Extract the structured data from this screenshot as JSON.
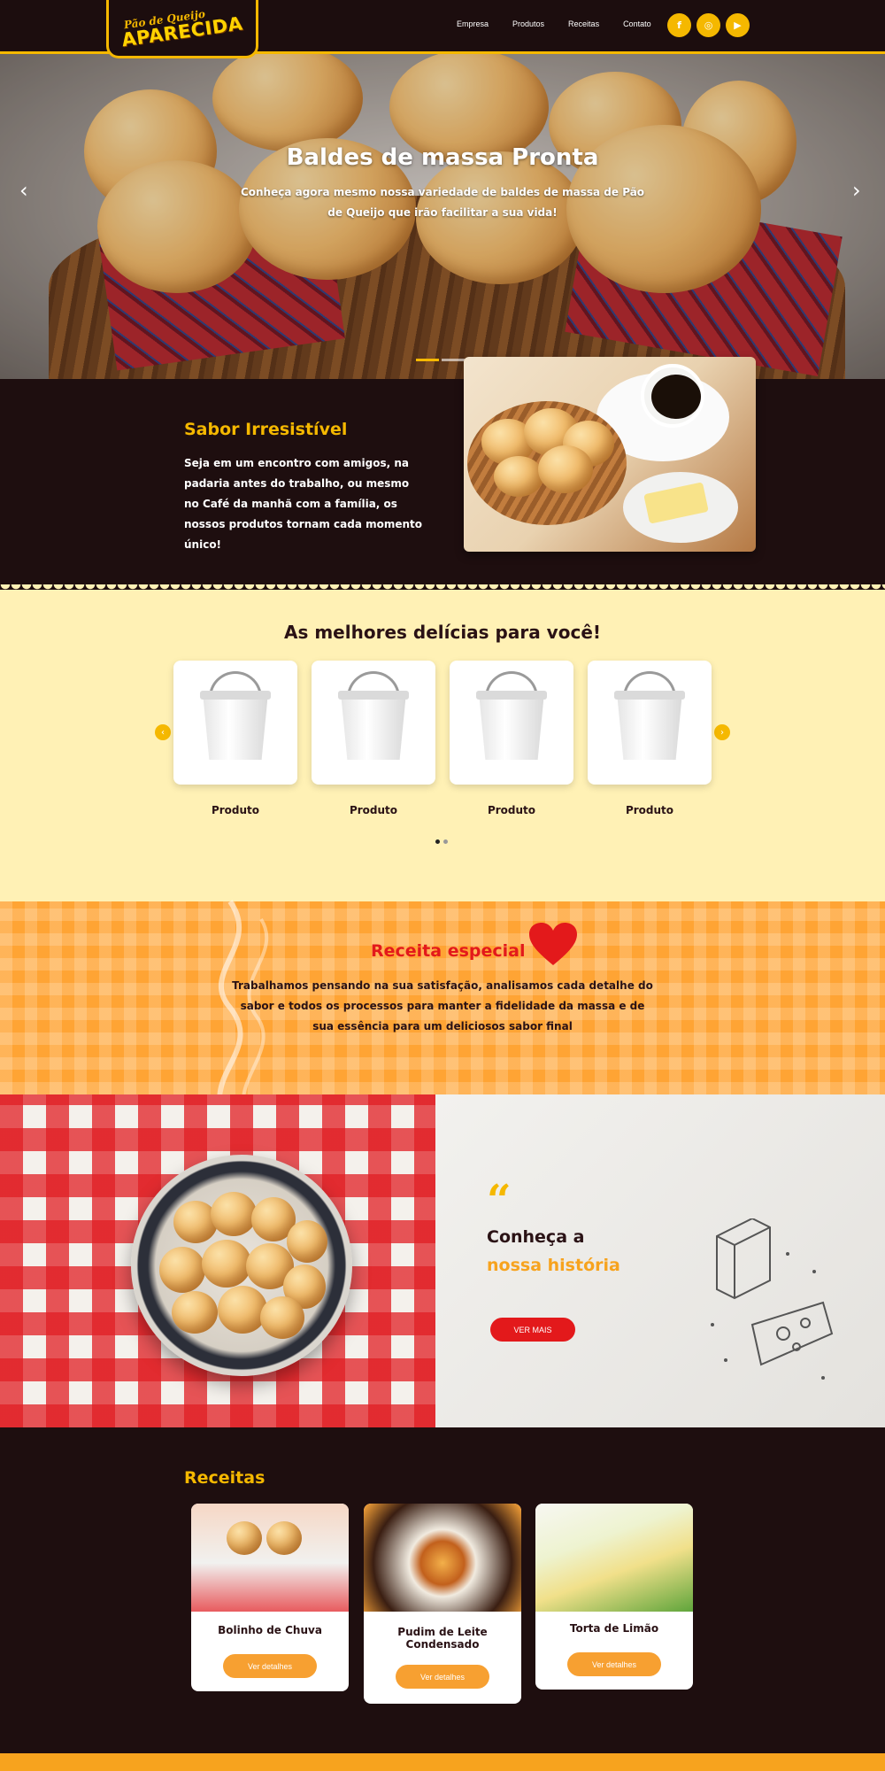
{
  "brand": {
    "logo_line1": "Pão de Queijo",
    "logo_line2": "APARECIDA"
  },
  "nav": {
    "items": [
      "Empresa",
      "Produtos",
      "Receitas",
      "Contato"
    ]
  },
  "social": {
    "icons": [
      "facebook-icon",
      "instagram-icon",
      "youtube-icon"
    ],
    "glyphs": [
      "f",
      "◎",
      "▶"
    ]
  },
  "hero": {
    "title": "Baldes de massa Pronta",
    "subtitle": "Conheça agora mesmo nossa variedade de baldes de massa de Pão de Queijo que irão facilitar a sua vida!",
    "prev": "‹",
    "next": "›",
    "active_slide": 0
  },
  "sabor": {
    "title": "Sabor Irresistível",
    "text": "Seja em um encontro com amigos, na padaria antes do trabalho, ou mesmo no Café da manhã com a família, os nossos produtos tornam cada momento único!"
  },
  "produtos": {
    "title": "As melhores delícias para você!",
    "items": [
      {
        "name": "Produto"
      },
      {
        "name": "Produto"
      },
      {
        "name": "Produto"
      },
      {
        "name": "Produto"
      }
    ],
    "prev": "‹",
    "next": "›"
  },
  "especial": {
    "title": "Receita especial",
    "text": "Trabalhamos pensando na sua satisfação, analisamos cada detalhe do sabor e todos os processos para manter a fidelidade da massa e de sua essência para um deliciosos sabor final"
  },
  "historia": {
    "quote": "“",
    "line1": "Conheça a",
    "line2": "nossa história",
    "button": "VER MAIS"
  },
  "receitas": {
    "title": "Receitas",
    "items": [
      {
        "name": "Bolinho de Chuva",
        "button": "Ver detalhes"
      },
      {
        "name": "Pudim de Leite Condensado",
        "button": "Ver detalhes"
      },
      {
        "name": "Torta de Limão",
        "button": "Ver detalhes"
      }
    ]
  },
  "colors": {
    "accent": "#f5b800",
    "dark": "#1e0e0f",
    "red": "#e3191b",
    "orange": "#f7a31e",
    "cream": "#fff1b5"
  }
}
